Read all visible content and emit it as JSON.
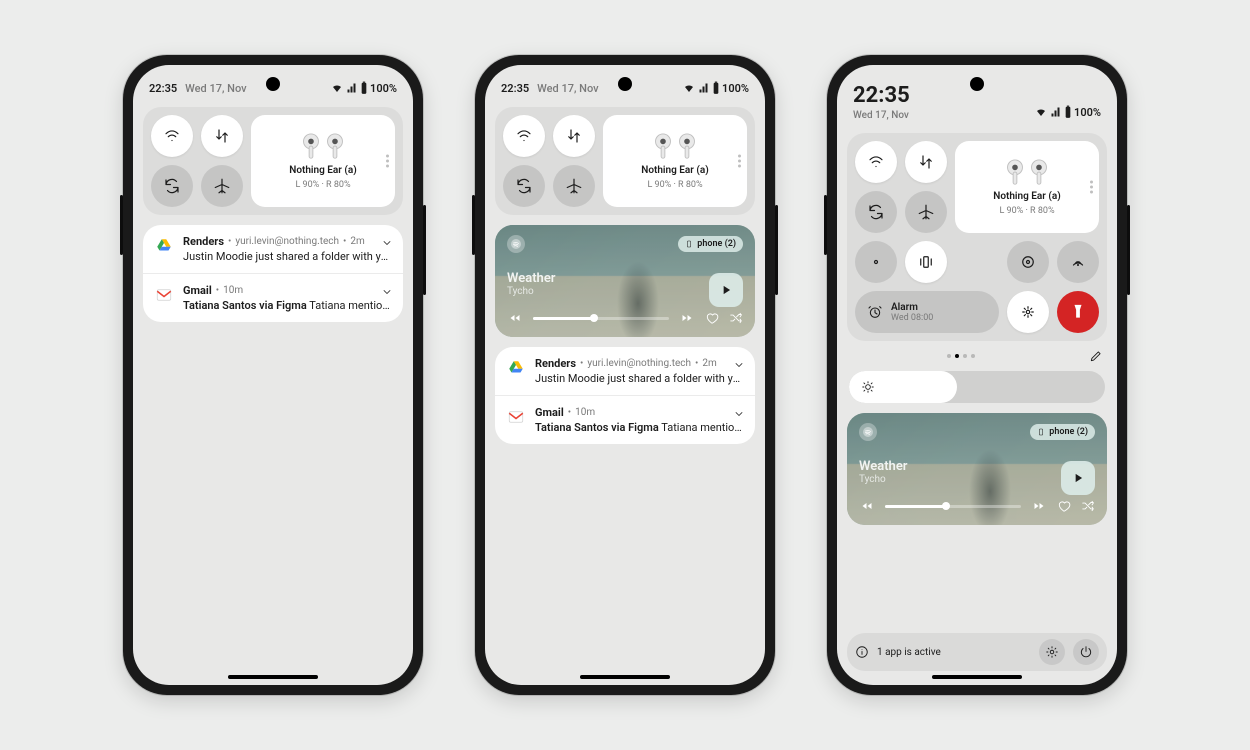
{
  "status": {
    "time": "22:35",
    "date": "Wed 17, Nov",
    "battery": "100%"
  },
  "earbuds": {
    "name": "Nothing Ear (a)",
    "battery": "L 90% · R 80%"
  },
  "alarm": {
    "label": "Alarm",
    "sub": "Wed 08:00"
  },
  "media": {
    "output_chip": "phone (2)",
    "title": "Weather",
    "artist": "Tycho"
  },
  "notifications": [
    {
      "app": "Renders",
      "meta": "yuri.levin@nothing.tech",
      "age": "2m",
      "body": "Justin Moodie just shared a folder with you"
    },
    {
      "app": "Gmail",
      "meta": "",
      "age": "10m",
      "body_strong": "Tatiana Santos via Figma",
      "body_rest": " Tatiana mention..."
    }
  ],
  "footer": {
    "active": "1 app is active"
  }
}
